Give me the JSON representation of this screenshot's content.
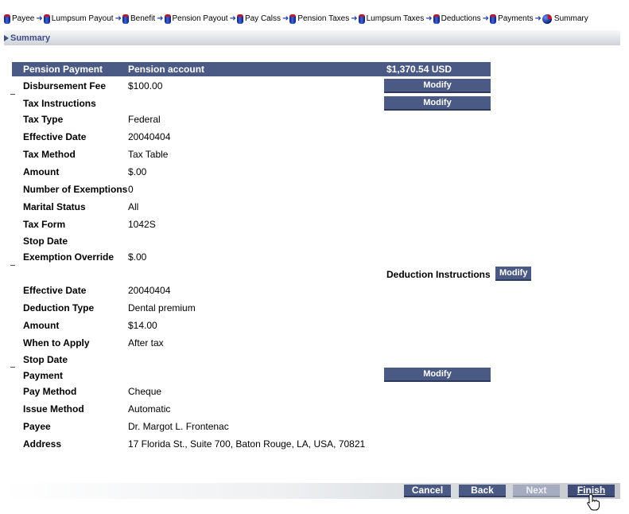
{
  "steps": [
    {
      "label": "Payee"
    },
    {
      "label": "Lumpsum Payout"
    },
    {
      "label": "Benefit"
    },
    {
      "label": "Pension Payout"
    },
    {
      "label": "Pay Calss"
    },
    {
      "label": "Pension Taxes"
    },
    {
      "label": "Lumpsum Taxes"
    },
    {
      "label": "Deductions"
    },
    {
      "label": "Payments"
    },
    {
      "label": "Summary"
    }
  ],
  "section": {
    "title": "Summary"
  },
  "header_row": {
    "label": "Pension Payment",
    "account": "Pension account",
    "amount": "$1,370.54 USD"
  },
  "disbursement": {
    "label": "Disbursement Fee",
    "value": "$100.00",
    "button": "Modify"
  },
  "tax": {
    "title": "Tax Instructions",
    "button": "Modify",
    "fields": [
      {
        "label": "Tax Type",
        "value": "Federal"
      },
      {
        "label": "Effective Date",
        "value": "20040404"
      },
      {
        "label": "Tax Method",
        "value": "Tax Table"
      },
      {
        "label": "Amount",
        "value": "$.00"
      },
      {
        "label": "Number of Exemptions",
        "value": "0"
      },
      {
        "label": "Marital Status",
        "value": "All"
      },
      {
        "label": "Tax Form",
        "value": "1042S"
      },
      {
        "label": "Stop Date",
        "value": ""
      },
      {
        "label": "Exemption Override",
        "value": "$.00"
      }
    ]
  },
  "deduction": {
    "title": "Deduction Instructions",
    "button": "Modify",
    "fields": [
      {
        "label": "Effective Date",
        "value": "20040404"
      },
      {
        "label": "Deduction Type",
        "value": "Dental premium"
      },
      {
        "label": "Amount",
        "value": "$14.00"
      },
      {
        "label": "When to Apply",
        "value": "After tax"
      },
      {
        "label": "Stop Date",
        "value": ""
      }
    ]
  },
  "payment": {
    "title": "Payment",
    "button": "Modify",
    "fields": [
      {
        "label": "Pay Method",
        "value": "Cheque"
      },
      {
        "label": "Issue Method",
        "value": "Automatic"
      },
      {
        "label": "Payee",
        "value": "Dr. Margot L. Frontenac"
      },
      {
        "label": "Address",
        "value": "17 Florida St., Suite 700, Baton Rouge, LA, USA, 70821"
      }
    ]
  },
  "footer": {
    "cancel": "Cancel",
    "back": "Back",
    "next": "Next",
    "finish": "Finish"
  },
  "colors": {
    "accent": "#4b5a84",
    "header_text": "#3d4f8a",
    "disabled": "#a5acc0"
  },
  "icons": {
    "step_marker": "cylinder-icon",
    "step_arrow": "arrow-right-icon",
    "cursor": "hand-pointer-icon"
  }
}
